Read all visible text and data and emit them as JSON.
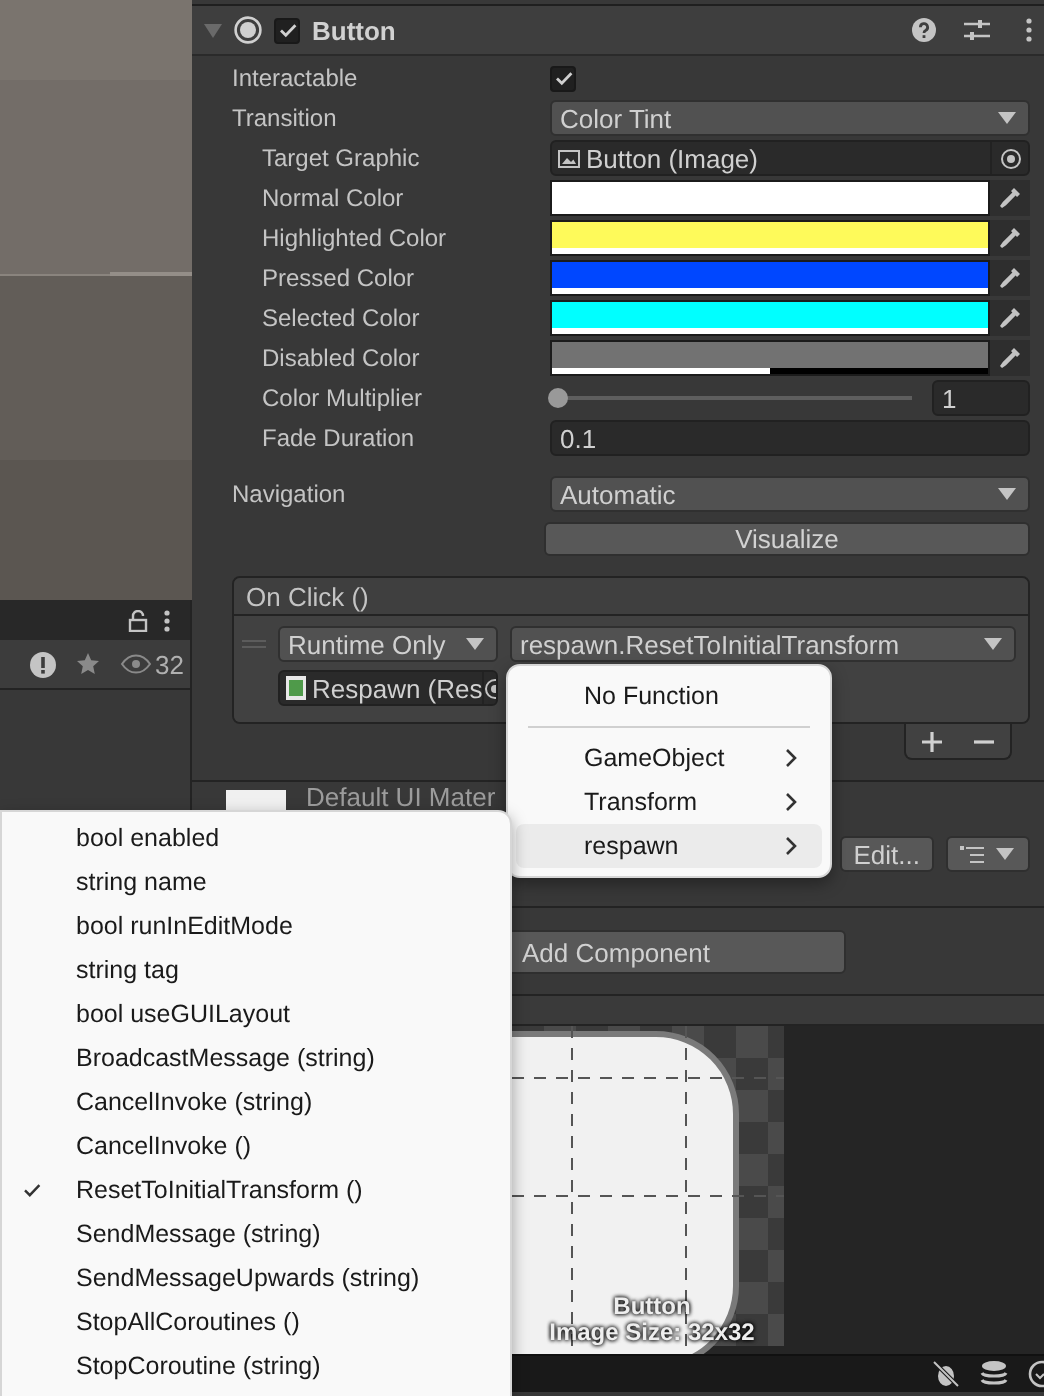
{
  "left_panel": {
    "view_count": "32"
  },
  "component": {
    "title": "Button",
    "enabled": true,
    "expanded": true
  },
  "properties": [
    {
      "kind": "checkbox",
      "label": "Interactable",
      "checked": true
    },
    {
      "kind": "dropdown",
      "label": "Transition",
      "value": "Color Tint",
      "children": [
        {
          "kind": "object",
          "label": "Target Graphic",
          "value": "Button (Image)"
        },
        {
          "kind": "color",
          "label": "Normal Color",
          "color": "#ffffff",
          "level": 1
        },
        {
          "kind": "color",
          "label": "Highlighted Color",
          "color": "#fefa5a",
          "level": 1
        },
        {
          "kind": "color",
          "label": "Pressed Color",
          "color": "#0047ff",
          "level": 1
        },
        {
          "kind": "color",
          "label": "Selected Color",
          "color": "#00ffff",
          "level": 1
        },
        {
          "kind": "color",
          "label": "Disabled Color",
          "color": "#727272",
          "level": 0.5
        },
        {
          "kind": "slider",
          "label": "Color Multiplier",
          "value": "1",
          "level": 0
        },
        {
          "kind": "number",
          "label": "Fade Duration",
          "value": "0.1"
        }
      ]
    },
    {
      "kind": "dropdown",
      "label": "Navigation",
      "value": "Automatic"
    }
  ],
  "visualize_button": "Visualize",
  "on_click": {
    "title": "On Click ()",
    "entries": [
      {
        "mode": "Runtime Only",
        "function": "respawn.ResetToInitialTransform",
        "target": "Respawn (Res"
      }
    ]
  },
  "material": {
    "name": "Default UI Mater",
    "edit_button": "Edit..."
  },
  "add_component_button": "Add Component",
  "preview": {
    "name": "Button",
    "size_label": "Image Size: 32x32"
  },
  "submenu": {
    "items": [
      {
        "kind": "item",
        "label": "No Function",
        "selected": false
      },
      {
        "kind": "separator"
      },
      {
        "kind": "submenu",
        "label": "GameObject",
        "selected": false
      },
      {
        "kind": "submenu",
        "label": "Transform",
        "selected": false
      },
      {
        "kind": "submenu",
        "label": "respawn",
        "selected": true
      }
    ]
  },
  "function_menu": {
    "items": [
      {
        "label": "bool enabled",
        "checked": false
      },
      {
        "label": "string name",
        "checked": false
      },
      {
        "label": "bool runInEditMode",
        "checked": false
      },
      {
        "label": "string tag",
        "checked": false
      },
      {
        "label": "bool useGUILayout",
        "checked": false
      },
      {
        "label": "BroadcastMessage (string)",
        "checked": false
      },
      {
        "label": "CancelInvoke (string)",
        "checked": false
      },
      {
        "label": "CancelInvoke ()",
        "checked": false
      },
      {
        "label": "ResetToInitialTransform ()",
        "checked": true
      },
      {
        "label": "SendMessage (string)",
        "checked": false
      },
      {
        "label": "SendMessageUpwards (string)",
        "checked": false
      },
      {
        "label": "StopAllCoroutines ()",
        "checked": false
      },
      {
        "label": "StopCoroutine (string)",
        "checked": false
      }
    ]
  }
}
